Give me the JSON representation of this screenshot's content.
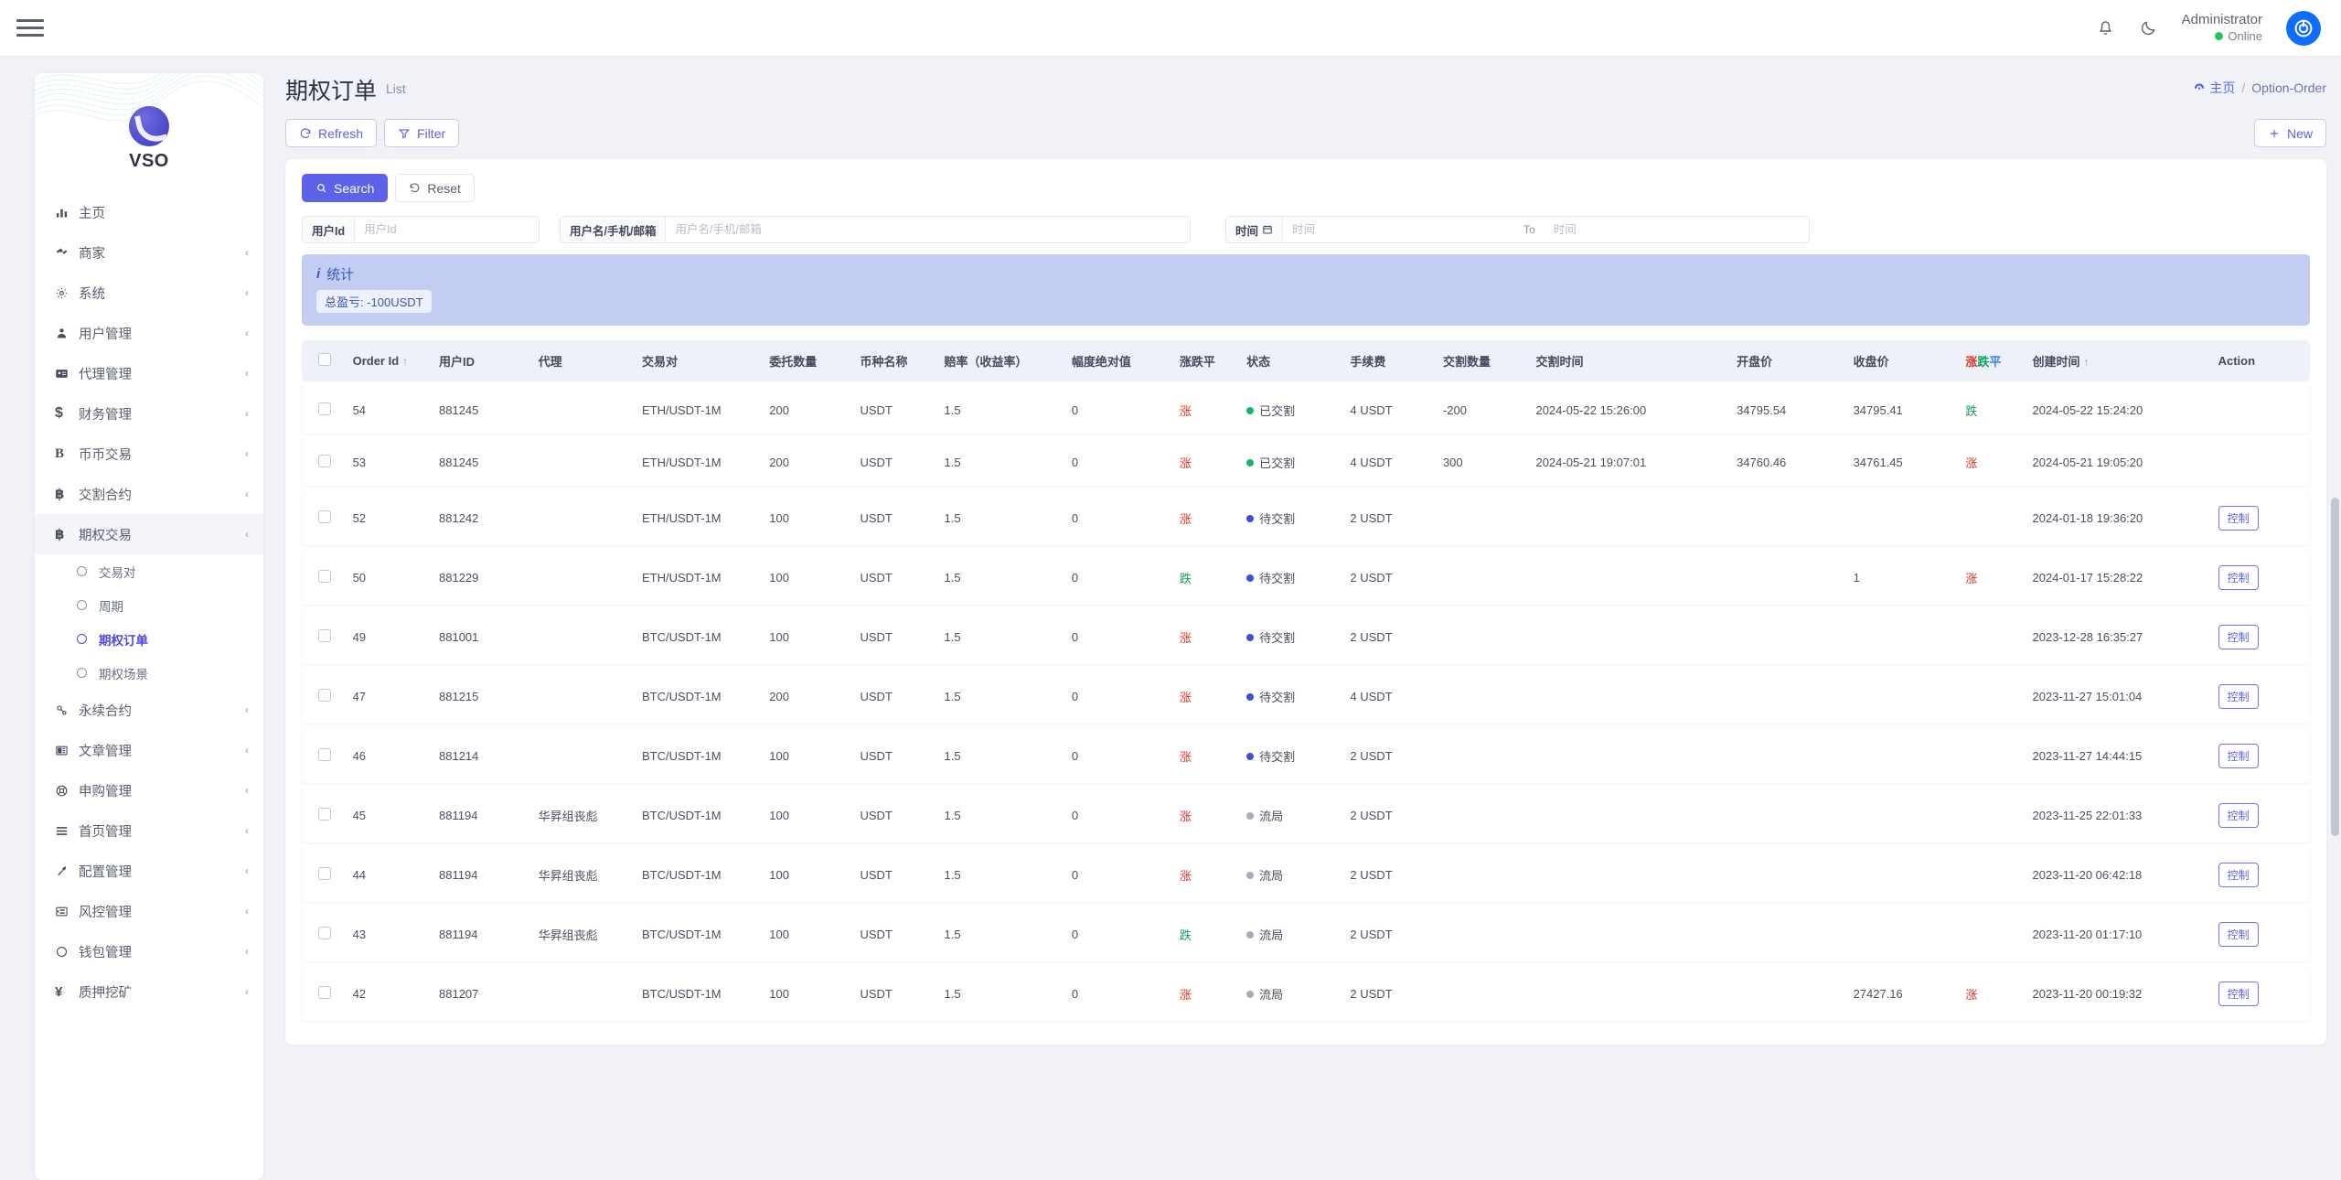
{
  "topbar": {
    "menu_icon": "hamburger-icon",
    "bell_icon": "bell-icon",
    "moon_icon": "moon-icon",
    "user_name": "Administrator",
    "user_status": "Online",
    "avatar_icon": "power-icon"
  },
  "sidebar": {
    "brand": "VSO",
    "items": [
      {
        "label": "主页",
        "icon": "chart-bar-icon",
        "expandable": false
      },
      {
        "label": "商家",
        "icon": "merchant-icon",
        "expandable": true
      },
      {
        "label": "系统",
        "icon": "gear-icon",
        "expandable": true
      },
      {
        "label": "用户管理",
        "icon": "user-icon",
        "expandable": true
      },
      {
        "label": "代理管理",
        "icon": "id-card-icon",
        "expandable": true
      },
      {
        "label": "财务管理",
        "icon": "dollar-icon",
        "expandable": true
      },
      {
        "label": "币币交易",
        "icon": "b-icon",
        "expandable": true
      },
      {
        "label": "交割合约",
        "icon": "bitcoin-icon",
        "expandable": true
      },
      {
        "label": "期权交易",
        "icon": "bitcoin-icon",
        "expandable": true,
        "active": true
      },
      {
        "label": "永续合约",
        "icon": "link-icon",
        "expandable": true
      },
      {
        "label": "文章管理",
        "icon": "news-icon",
        "expandable": true
      },
      {
        "label": "申购管理",
        "icon": "lifebuoy-icon",
        "expandable": true
      },
      {
        "label": "首页管理",
        "icon": "lines-icon",
        "expandable": true
      },
      {
        "label": "配置管理",
        "icon": "wrench-icon",
        "expandable": true
      },
      {
        "label": "风控管理",
        "icon": "indent-icon",
        "expandable": true
      },
      {
        "label": "钱包管理",
        "icon": "circle-icon",
        "expandable": true
      },
      {
        "label": "质押挖矿",
        "icon": "yen-icon",
        "expandable": true
      }
    ],
    "submenu": [
      {
        "label": "交易对",
        "selected": false
      },
      {
        "label": "周期",
        "selected": false
      },
      {
        "label": "期权订单",
        "selected": true
      },
      {
        "label": "期权场景",
        "selected": false
      }
    ]
  },
  "page": {
    "title": "期权订单",
    "subtitle": "List",
    "breadcrumb": {
      "home": "主页",
      "sep": "/",
      "current": "Option-Order",
      "home_icon": "dashboard-icon"
    },
    "toolbar": {
      "refresh_label": "Refresh",
      "refresh_icon": "refresh-icon",
      "filter_label": "Filter",
      "filter_icon": "funnel-icon",
      "new_label": "New",
      "new_icon": "plus-icon"
    },
    "search": {
      "search_label": "Search",
      "search_icon": "search-icon",
      "reset_label": "Reset",
      "reset_icon": "undo-icon",
      "fields": [
        {
          "label": "用户Id",
          "placeholder": "用户Id",
          "value": ""
        },
        {
          "label": "用户名/手机/邮箱",
          "placeholder": "用户名/手机/邮箱",
          "value": ""
        },
        {
          "label": "时间",
          "icon": "calendar-icon",
          "placeholder": "时间",
          "value": ""
        }
      ],
      "to_label": "To",
      "to_placeholder": "时间"
    },
    "stats": {
      "title": "统计",
      "icon": "info-icon",
      "pill": "总盈亏: -100USDT"
    }
  },
  "table": {
    "columns": [
      {
        "key": "check",
        "label": ""
      },
      {
        "key": "order_id",
        "label": "Order Id",
        "sort": "↑"
      },
      {
        "key": "user_id",
        "label": "用户ID"
      },
      {
        "key": "agent",
        "label": "代理"
      },
      {
        "key": "pair",
        "label": "交易对"
      },
      {
        "key": "amount",
        "label": "委托数量"
      },
      {
        "key": "coin",
        "label": "币种名称"
      },
      {
        "key": "odds",
        "label": "赔率（收益率）"
      },
      {
        "key": "abs_amp",
        "label": "幅度绝对值"
      },
      {
        "key": "direction",
        "label": "涨跌平"
      },
      {
        "key": "status",
        "label": "状态"
      },
      {
        "key": "fee",
        "label": "手续费"
      },
      {
        "key": "settle_qty",
        "label": "交割数量"
      },
      {
        "key": "settle_time",
        "label": "交割时间"
      },
      {
        "key": "open_price",
        "label": "开盘价"
      },
      {
        "key": "close_price",
        "label": "收盘价"
      },
      {
        "key": "result",
        "label": "涨跌平",
        "colored": true
      },
      {
        "key": "created",
        "label": "创建时间",
        "sort": "↑"
      },
      {
        "key": "action",
        "label": "Action"
      }
    ],
    "result_header_chars": [
      {
        "ch": "涨",
        "color": "#e2342a"
      },
      {
        "ch": "跌",
        "color": "#13a05c"
      },
      {
        "ch": "平",
        "color": "#3b82f6"
      }
    ],
    "control_label": "控制",
    "rows": [
      {
        "order_id": "54",
        "user_id": "881245",
        "agent": "",
        "pair": "ETH/USDT-1M",
        "amount": "200",
        "coin": "USDT",
        "odds": "1.5",
        "abs_amp": "0",
        "direction": "涨",
        "direction_kind": "up",
        "status": "已交割",
        "status_kind": "green",
        "fee": "4 USDT",
        "settle_qty": "-200",
        "settle_time": "2024-05-22 15:26:00",
        "open_price": "34795.54",
        "close_price": "34795.41",
        "result": "跌",
        "result_kind": "down",
        "created": "2024-05-22 15:24:20",
        "action": ""
      },
      {
        "order_id": "53",
        "user_id": "881245",
        "agent": "",
        "pair": "ETH/USDT-1M",
        "amount": "200",
        "coin": "USDT",
        "odds": "1.5",
        "abs_amp": "0",
        "direction": "涨",
        "direction_kind": "up",
        "status": "已交割",
        "status_kind": "green",
        "fee": "4 USDT",
        "settle_qty": "300",
        "settle_time": "2024-05-21 19:07:01",
        "open_price": "34760.46",
        "close_price": "34761.45",
        "result": "涨",
        "result_kind": "up",
        "created": "2024-05-21 19:05:20",
        "action": ""
      },
      {
        "order_id": "52",
        "user_id": "881242",
        "agent": "",
        "pair": "ETH/USDT-1M",
        "amount": "100",
        "coin": "USDT",
        "odds": "1.5",
        "abs_amp": "0",
        "direction": "涨",
        "direction_kind": "up",
        "status": "待交割",
        "status_kind": "blue",
        "fee": "2 USDT",
        "settle_qty": "",
        "settle_time": "",
        "open_price": "",
        "close_price": "",
        "result": "",
        "result_kind": "",
        "created": "2024-01-18 19:36:20",
        "action": "控制"
      },
      {
        "order_id": "50",
        "user_id": "881229",
        "agent": "",
        "pair": "ETH/USDT-1M",
        "amount": "100",
        "coin": "USDT",
        "odds": "1.5",
        "abs_amp": "0",
        "direction": "跌",
        "direction_kind": "down",
        "status": "待交割",
        "status_kind": "blue",
        "fee": "2 USDT",
        "settle_qty": "",
        "settle_time": "",
        "open_price": "",
        "close_price": "1",
        "result": "涨",
        "result_kind": "up",
        "created": "2024-01-17 15:28:22",
        "action": "控制"
      },
      {
        "order_id": "49",
        "user_id": "881001",
        "agent": "",
        "pair": "BTC/USDT-1M",
        "amount": "100",
        "coin": "USDT",
        "odds": "1.5",
        "abs_amp": "0",
        "direction": "涨",
        "direction_kind": "up",
        "status": "待交割",
        "status_kind": "blue",
        "fee": "2 USDT",
        "settle_qty": "",
        "settle_time": "",
        "open_price": "",
        "close_price": "",
        "result": "",
        "result_kind": "",
        "created": "2023-12-28 16:35:27",
        "action": "控制"
      },
      {
        "order_id": "47",
        "user_id": "881215",
        "agent": "",
        "pair": "BTC/USDT-1M",
        "amount": "200",
        "coin": "USDT",
        "odds": "1.5",
        "abs_amp": "0",
        "direction": "涨",
        "direction_kind": "up",
        "status": "待交割",
        "status_kind": "blue",
        "fee": "4 USDT",
        "settle_qty": "",
        "settle_time": "",
        "open_price": "",
        "close_price": "",
        "result": "",
        "result_kind": "",
        "created": "2023-11-27 15:01:04",
        "action": "控制"
      },
      {
        "order_id": "46",
        "user_id": "881214",
        "agent": "",
        "pair": "BTC/USDT-1M",
        "amount": "100",
        "coin": "USDT",
        "odds": "1.5",
        "abs_amp": "0",
        "direction": "涨",
        "direction_kind": "up",
        "status": "待交割",
        "status_kind": "blue",
        "fee": "2 USDT",
        "settle_qty": "",
        "settle_time": "",
        "open_price": "",
        "close_price": "",
        "result": "",
        "result_kind": "",
        "created": "2023-11-27 14:44:15",
        "action": "控制"
      },
      {
        "order_id": "45",
        "user_id": "881194",
        "agent": "华昇组丧彪",
        "pair": "BTC/USDT-1M",
        "amount": "100",
        "coin": "USDT",
        "odds": "1.5",
        "abs_amp": "0",
        "direction": "涨",
        "direction_kind": "up",
        "status": "流局",
        "status_kind": "gray",
        "fee": "2 USDT",
        "settle_qty": "",
        "settle_time": "",
        "open_price": "",
        "close_price": "",
        "result": "",
        "result_kind": "",
        "created": "2023-11-25 22:01:33",
        "action": "控制"
      },
      {
        "order_id": "44",
        "user_id": "881194",
        "agent": "华昇组丧彪",
        "pair": "BTC/USDT-1M",
        "amount": "100",
        "coin": "USDT",
        "odds": "1.5",
        "abs_amp": "0",
        "direction": "涨",
        "direction_kind": "up",
        "status": "流局",
        "status_kind": "gray",
        "fee": "2 USDT",
        "settle_qty": "",
        "settle_time": "",
        "open_price": "",
        "close_price": "",
        "result": "",
        "result_kind": "",
        "created": "2023-11-20 06:42:18",
        "action": "控制"
      },
      {
        "order_id": "43",
        "user_id": "881194",
        "agent": "华昇组丧彪",
        "pair": "BTC/USDT-1M",
        "amount": "100",
        "coin": "USDT",
        "odds": "1.5",
        "abs_amp": "0",
        "direction": "跌",
        "direction_kind": "down",
        "status": "流局",
        "status_kind": "gray",
        "fee": "2 USDT",
        "settle_qty": "",
        "settle_time": "",
        "open_price": "",
        "close_price": "",
        "result": "",
        "result_kind": "",
        "created": "2023-11-20 01:17:10",
        "action": "控制"
      },
      {
        "order_id": "42",
        "user_id": "881207",
        "agent": "",
        "pair": "BTC/USDT-1M",
        "amount": "100",
        "coin": "USDT",
        "odds": "1.5",
        "abs_amp": "0",
        "direction": "涨",
        "direction_kind": "up",
        "status": "流局",
        "status_kind": "gray",
        "fee": "2 USDT",
        "settle_qty": "",
        "settle_time": "",
        "open_price": "",
        "close_price": "27427.16",
        "result": "涨",
        "result_kind": "up",
        "created": "2023-11-20 00:19:32",
        "action": "控制"
      }
    ]
  },
  "colors": {
    "accent": "#5c63e8",
    "up": "#e2342a",
    "down": "#13a05c",
    "flat": "#3b82f6",
    "stats_bg": "#c3cdf2"
  }
}
